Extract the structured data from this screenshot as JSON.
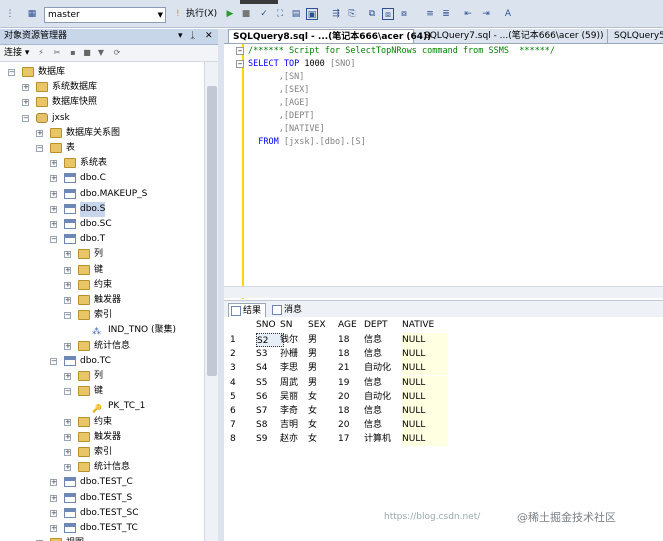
{
  "toolbar": {
    "database": "master",
    "execute_label": "执行(X)"
  },
  "explorer": {
    "title": "对象资源管理器",
    "connect_label": "连接",
    "pin": "ᛣ",
    "close": "✕"
  },
  "tree": [
    {
      "label": "数据库",
      "exp": "−",
      "icon": "folder"
    },
    {
      "label": "系统数据库",
      "exp": "+",
      "icon": "folder"
    },
    {
      "label": "数据库快照",
      "exp": "+",
      "icon": "folder"
    },
    {
      "label": "jxsk",
      "exp": "−",
      "icon": "db"
    },
    {
      "label": "数据库关系图",
      "exp": "+",
      "icon": "folder"
    },
    {
      "label": "表",
      "exp": "−",
      "icon": "folder"
    },
    {
      "label": "系统表",
      "exp": "+",
      "icon": "folder"
    },
    {
      "label": "dbo.C",
      "exp": "+",
      "icon": "table"
    },
    {
      "label": "dbo.MAKEUP_S",
      "exp": "+",
      "icon": "table"
    },
    {
      "label": "dbo.S",
      "exp": "+",
      "icon": "table"
    },
    {
      "label": "dbo.SC",
      "exp": "+",
      "icon": "table"
    },
    {
      "label": "dbo.T",
      "exp": "−",
      "icon": "table"
    },
    {
      "label": "列",
      "exp": "+",
      "icon": "folder"
    },
    {
      "label": "键",
      "exp": "+",
      "icon": "folder"
    },
    {
      "label": "约束",
      "exp": "+",
      "icon": "folder"
    },
    {
      "label": "触发器",
      "exp": "+",
      "icon": "folder"
    },
    {
      "label": "索引",
      "exp": "−",
      "icon": "folder"
    },
    {
      "label": "IND_TNO (聚集)",
      "exp": "",
      "icon": "index"
    },
    {
      "label": "统计信息",
      "exp": "+",
      "icon": "folder"
    },
    {
      "label": "dbo.TC",
      "exp": "−",
      "icon": "table"
    },
    {
      "label": "列",
      "exp": "+",
      "icon": "folder"
    },
    {
      "label": "键",
      "exp": "−",
      "icon": "folder"
    },
    {
      "label": "PK_TC_1",
      "exp": "",
      "icon": "key"
    },
    {
      "label": "约束",
      "exp": "+",
      "icon": "folder"
    },
    {
      "label": "触发器",
      "exp": "+",
      "icon": "folder"
    },
    {
      "label": "索引",
      "exp": "+",
      "icon": "folder"
    },
    {
      "label": "统计信息",
      "exp": "+",
      "icon": "folder"
    },
    {
      "label": "dbo.TEST_C",
      "exp": "+",
      "icon": "table"
    },
    {
      "label": "dbo.TEST_S",
      "exp": "+",
      "icon": "table"
    },
    {
      "label": "dbo.TEST_SC",
      "exp": "+",
      "icon": "table"
    },
    {
      "label": "dbo.TEST_TC",
      "exp": "+",
      "icon": "table"
    },
    {
      "label": "视图",
      "exp": "+",
      "icon": "folder"
    }
  ],
  "tabs": [
    "SQLQuery8.sql - ...(笔记本666\\acer (64))",
    "SQLQuery7.sql - ...(笔记本666\\acer (59))",
    "SQLQuery5"
  ],
  "editor": {
    "comment": "/****** Script for SelectTopNRows command from SSMS  ******/",
    "select_kw": "SELECT",
    "top_kw": "TOP",
    "top_num": "1000",
    "cols": [
      "[SNO]",
      ",[SN]",
      ",[SEX]",
      ",[AGE]",
      ",[DEPT]",
      ",[NATIVE]"
    ],
    "from_kw": "FROM",
    "from_obj": "[jxsk].[dbo].[S]"
  },
  "results": {
    "tab_results": "结果",
    "tab_messages": "消息",
    "columns": [
      "SNO",
      "SN",
      "SEX",
      "AGE",
      "DEPT",
      "NATIVE"
    ],
    "rows": [
      [
        "1",
        "S2",
        "钱尔",
        "男",
        "18",
        "信息",
        "NULL"
      ],
      [
        "2",
        "S3",
        "孙栅",
        "男",
        "18",
        "信息",
        "NULL"
      ],
      [
        "3",
        "S4",
        "李思",
        "男",
        "21",
        "自动化",
        "NULL"
      ],
      [
        "4",
        "S5",
        "周武",
        "男",
        "19",
        "信息",
        "NULL"
      ],
      [
        "5",
        "S6",
        "吴丽",
        "女",
        "20",
        "自动化",
        "NULL"
      ],
      [
        "6",
        "S7",
        "李奇",
        "女",
        "18",
        "信息",
        "NULL"
      ],
      [
        "7",
        "S8",
        "吉明",
        "女",
        "20",
        "信息",
        "NULL"
      ],
      [
        "8",
        "S9",
        "赵亦",
        "女",
        "17",
        "计算机",
        "NULL"
      ]
    ]
  },
  "watermark": "https://blog.csdn.net/",
  "watermark2": "@稀土掘金技术社区"
}
